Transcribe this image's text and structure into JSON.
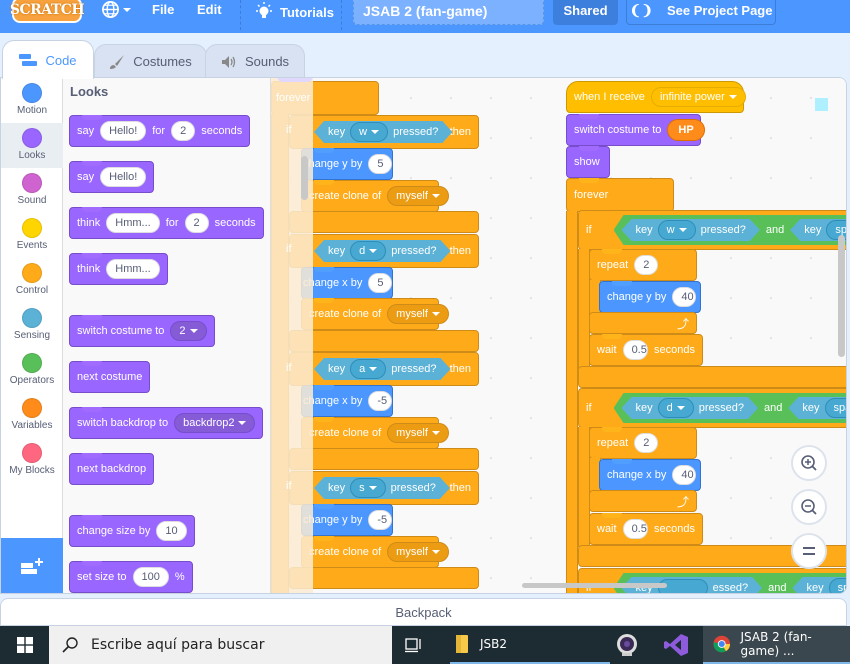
{
  "menubar": {
    "logo": "SCRATCH",
    "file": "File",
    "edit": "Edit",
    "tutorials": "Tutorials",
    "project_title": "JSAB 2 (fan-game)",
    "shared": "Shared",
    "see_project_page": "See Project Page"
  },
  "tabs": [
    {
      "label": "Code",
      "active": true
    },
    {
      "label": "Costumes",
      "active": false
    },
    {
      "label": "Sounds",
      "active": false
    }
  ],
  "categories": [
    {
      "label": "Motion",
      "color": "#4c97ff"
    },
    {
      "label": "Looks",
      "color": "#9966ff",
      "selected": true
    },
    {
      "label": "Sound",
      "color": "#cf63cf"
    },
    {
      "label": "Events",
      "color": "#ffd500"
    },
    {
      "label": "Control",
      "color": "#ffab19"
    },
    {
      "label": "Sensing",
      "color": "#5cb1d6"
    },
    {
      "label": "Operators",
      "color": "#59c059"
    },
    {
      "label": "Variables",
      "color": "#ff8c1a"
    },
    {
      "label": "My Blocks",
      "color": "#ff6680"
    }
  ],
  "palette": {
    "title": "Looks",
    "blocks": {
      "say_for": {
        "say": "say",
        "msg": "Hello!",
        "for": "for",
        "secs": "2",
        "seconds": "seconds"
      },
      "say": {
        "say": "say",
        "msg": "Hello!"
      },
      "think_for": {
        "think": "think",
        "msg": "Hmm...",
        "for": "for",
        "secs": "2",
        "seconds": "seconds"
      },
      "think": {
        "think": "think",
        "msg": "Hmm..."
      },
      "switch_costume": {
        "label": "switch costume to",
        "value": "2"
      },
      "next_costume": "next costume",
      "switch_backdrop": {
        "label": "switch backdrop to",
        "value": "backdrop2"
      },
      "next_backdrop": "next backdrop",
      "change_size": {
        "label": "change size by",
        "value": "10"
      },
      "set_size": {
        "label": "set size to",
        "value": "100",
        "unit": "%"
      }
    }
  },
  "script_left": {
    "forever": "forever",
    "if": "if",
    "then": "then",
    "key": "key",
    "pressed": "pressed?",
    "create_clone": "create clone of",
    "myself": "myself",
    "groups": [
      {
        "key": "w",
        "move": "change y by",
        "amount": "5"
      },
      {
        "key": "d",
        "move": "change x by",
        "amount": "5"
      },
      {
        "key": "a",
        "move": "change x by",
        "amount": "-5"
      },
      {
        "key": "s",
        "move": "change y by",
        "amount": "-5"
      }
    ]
  },
  "script_right": {
    "when_receive": "when I receive",
    "message": "infinite power",
    "switch_costume": "switch costume to",
    "costume": "HP",
    "show": "show",
    "forever": "forever",
    "if": "if",
    "key": "key",
    "pressed": "pressed?",
    "and": "and",
    "space": "space",
    "repeat": "repeat",
    "wait": "wait",
    "seconds": "seconds",
    "groups": [
      {
        "key": "w",
        "repeat": "2",
        "move": "change y by",
        "amount": "40",
        "wait": "0.5"
      },
      {
        "key": "d",
        "repeat": "2",
        "move": "change x by",
        "amount": "40",
        "wait": "0.5"
      }
    ],
    "partial_pressed": "essed?"
  },
  "backpack": "Backpack",
  "taskbar": {
    "search_placeholder": "Escribe aquí para buscar",
    "folder": "JSB2",
    "chrome": "JSAB 2 (fan-game) ..."
  }
}
